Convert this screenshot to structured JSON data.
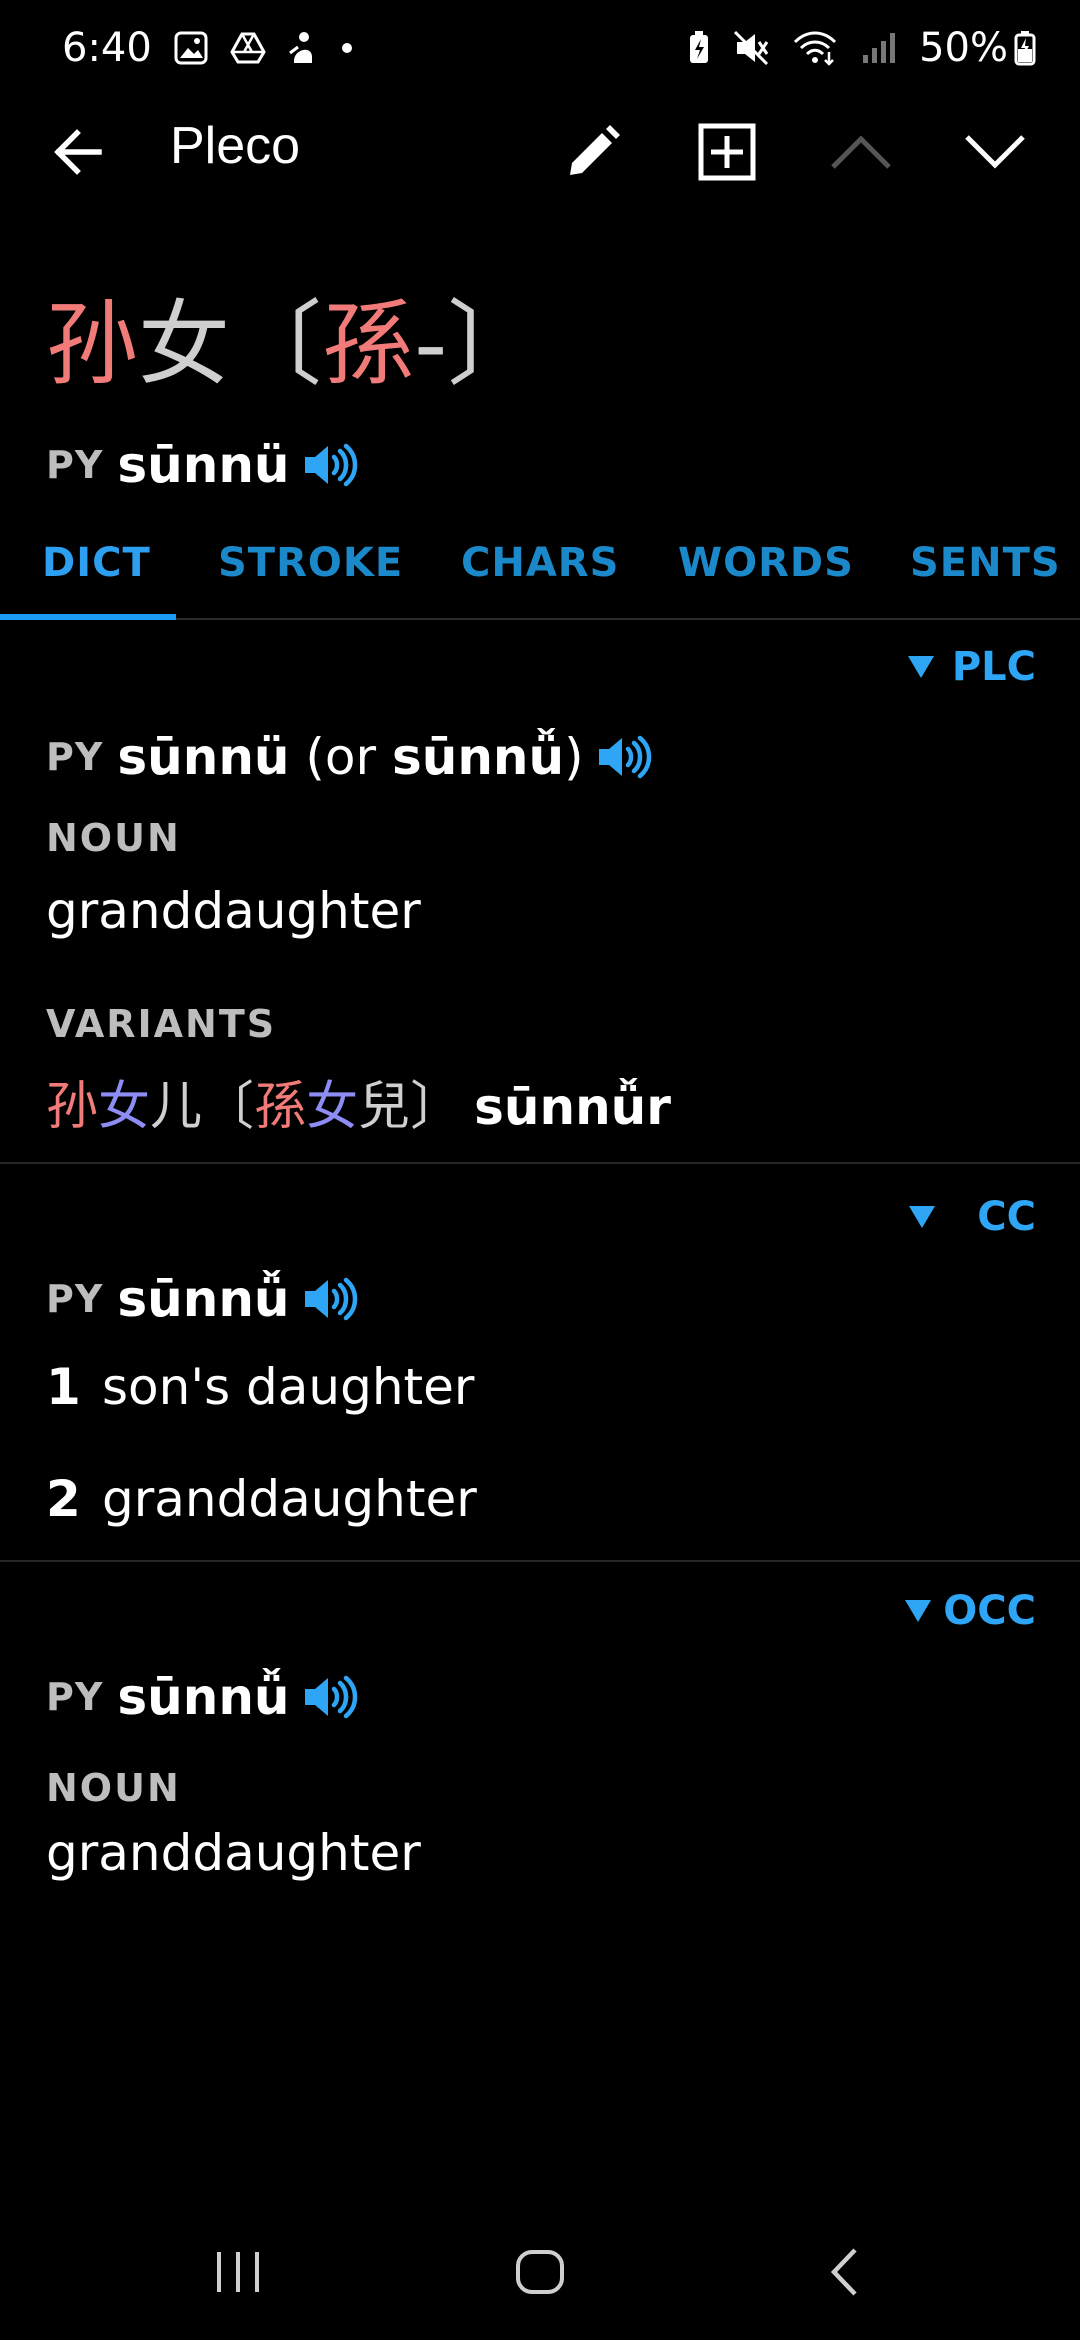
{
  "status": {
    "time": "6:40",
    "battery": "50%"
  },
  "app_bar": {
    "title": "Pleco"
  },
  "headword": {
    "simplified": [
      "孙",
      "女"
    ],
    "traditional_open": "〔",
    "traditional_char": "孫",
    "traditional_rest": "-〕"
  },
  "pinyin": {
    "label": "PY",
    "text": "sūnnü"
  },
  "tabs": [
    "DICT",
    "STROKE",
    "CHARS",
    "WORDS",
    "SENTS"
  ],
  "sections": [
    {
      "source": "PLC",
      "py_label": "PY",
      "py_main": "sūnnü",
      "py_or_open": " (or ",
      "py_alt": "sūnnǚ",
      "py_or_close": ")",
      "pos": "NOUN",
      "definition": "granddaughter",
      "variants_label": "VARIANTS",
      "variant": {
        "c1": "孙",
        "c2": "女",
        "c3": "儿",
        "open": "〔",
        "t1": "孫",
        "t2": "女",
        "t3": "兒",
        "close": "〕",
        "pinyin": "sūnnǚr"
      }
    },
    {
      "source": "CC",
      "py_label": "PY",
      "py_main": "sūnnǚ",
      "definitions": [
        {
          "num": "1",
          "text": "son's daughter"
        },
        {
          "num": "2",
          "text": "granddaughter"
        }
      ]
    },
    {
      "source": "OCC",
      "py_label": "PY",
      "py_main": "sūnnǚ",
      "pos": "NOUN",
      "definition": "granddaughter"
    }
  ],
  "colors": {
    "accent": "#2ea5f5",
    "tone1": "#f07b78",
    "tone3": "#8e8cf5",
    "neutral": "#cfcfcf"
  },
  "icons": {
    "back": "arrow-left-icon",
    "edit": "pencil-icon",
    "add": "add-box-icon",
    "prev": "chevron-up-icon",
    "next": "chevron-down-icon",
    "speaker": "speaker-icon"
  }
}
